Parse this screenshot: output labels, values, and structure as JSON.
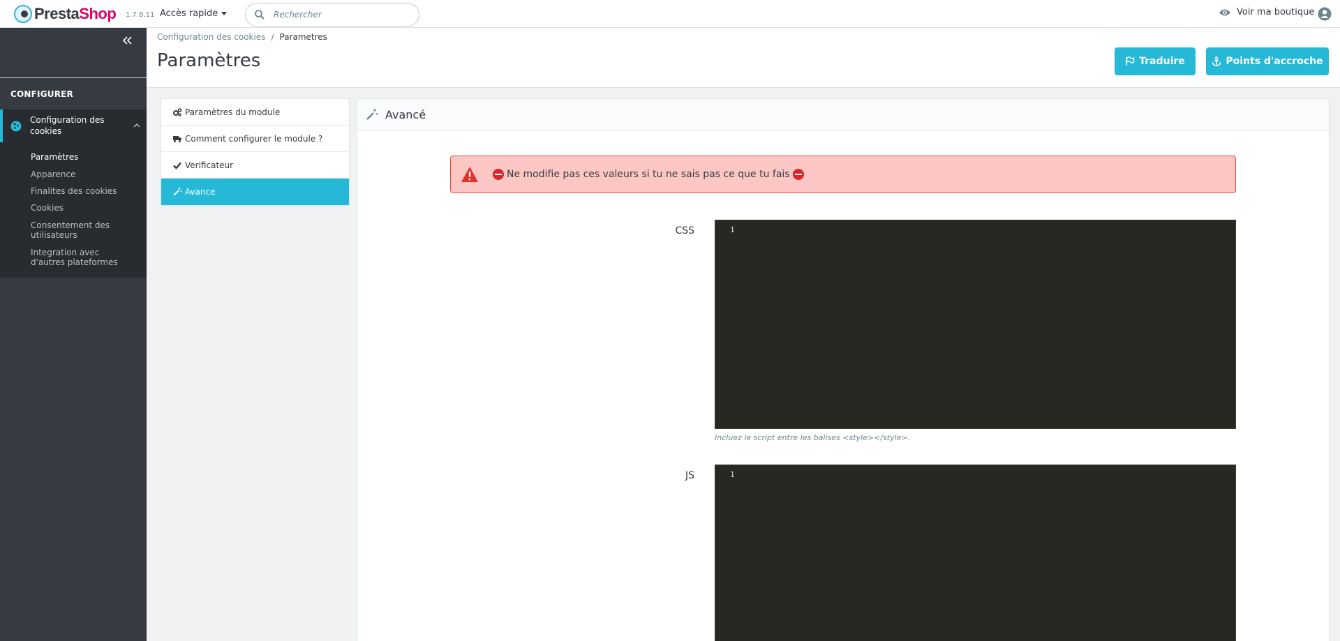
{
  "header": {
    "brand_dark": "Presta",
    "brand_pink": "Shop",
    "version": "1.7.8.11",
    "quick_access": "Accès rapide",
    "search_placeholder": "Rechercher",
    "view_shop": "Voir ma boutique"
  },
  "sidebar": {
    "section_title": "CONFIGURER",
    "active_item": "Configuration des cookies",
    "submenu": [
      "Paramètres",
      "Apparence",
      "Finalites des cookies",
      "Cookies",
      "Consentement des utilisateurs",
      "Integration avec d'autres plateformes"
    ]
  },
  "page": {
    "breadcrumb_parent": "Configuration des cookies",
    "breadcrumb_sep": "/",
    "breadcrumb_current": "Parametres",
    "title": "Paramètres",
    "translate_button": "Traduire",
    "hooks_button": "Points d'accroche"
  },
  "tabs": [
    {
      "label": "Paramètres du module",
      "icon": "cogs-icon"
    },
    {
      "label": "Comment configurer le module ?",
      "icon": "truck-icon"
    },
    {
      "label": "Verificateur",
      "icon": "check-icon"
    },
    {
      "label": "Avance",
      "icon": "magic-wand-icon"
    }
  ],
  "panel": {
    "title": "Avancé",
    "warning": "Ne modifie pas ces valeurs si tu ne sais pas ce que tu fais",
    "css_label": "CSS",
    "css_line": "1",
    "css_help": "Incluez le script entre les balises <style></style>.",
    "js_label": "JS",
    "js_line": "1"
  },
  "colors": {
    "accent": "#25b9d7",
    "sidebar_bg": "#363a41",
    "brand_pink": "#df0067",
    "alert_bg": "#fbc6c3",
    "alert_border": "#f54c3e",
    "editor_bg": "#272822"
  }
}
